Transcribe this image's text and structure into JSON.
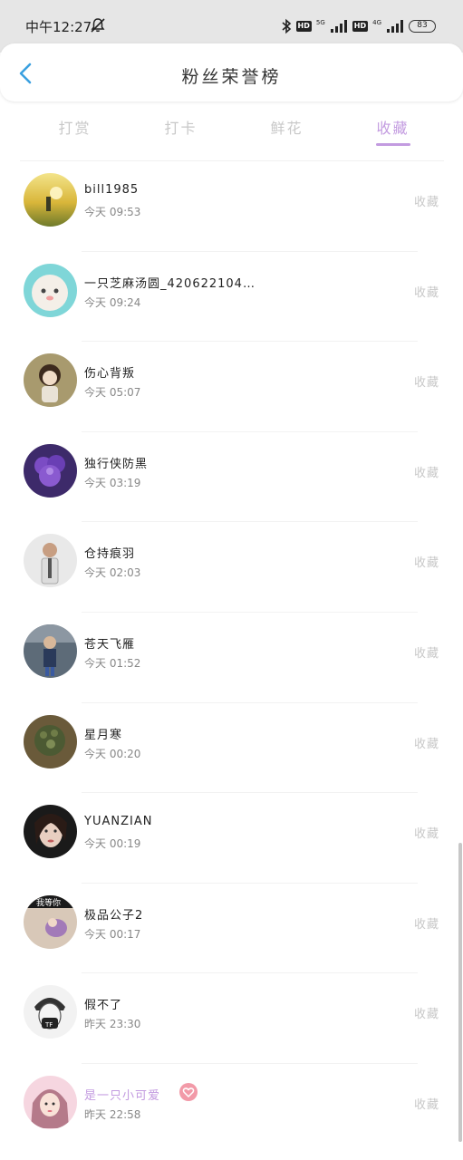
{
  "status_bar": {
    "time": "中午12:27",
    "net1": "5G",
    "net2": "4G",
    "hd": "HD",
    "battery": "83",
    "icons": [
      "bell-off-icon",
      "bluetooth-icon",
      "signal-icon",
      "battery-icon"
    ]
  },
  "header": {
    "title": "粉丝荣誉榜",
    "back_icon": "chevron-left-icon"
  },
  "tabs": [
    {
      "label": "打赏"
    },
    {
      "label": "打卡"
    },
    {
      "label": "鲜花"
    },
    {
      "label": "收藏"
    }
  ],
  "active_tab": "收藏",
  "colors": {
    "accent": "#c39be0",
    "back_arrow": "#3aa0e0",
    "status_bg": "#e6e6e6"
  },
  "fans": [
    {
      "name": "bill1985",
      "time": "今天 09:53",
      "action": "收藏"
    },
    {
      "name": "一只芝麻汤圆_420622104…",
      "time": "今天 09:24",
      "action": "收藏"
    },
    {
      "name": "伤心背叛",
      "time": "今天 05:07",
      "action": "收藏"
    },
    {
      "name": "独行侠防黑",
      "time": "今天 03:19",
      "action": "收藏"
    },
    {
      "name": "仓持痕羽",
      "time": "今天 02:03",
      "action": "收藏"
    },
    {
      "name": "苍天飞雁",
      "time": "今天 01:52",
      "action": "收藏"
    },
    {
      "name": "星月寒",
      "time": "今天 00:20",
      "action": "收藏"
    },
    {
      "name": "YUANZIAN",
      "time": "今天 00:19",
      "action": "收藏"
    },
    {
      "name": "极品公子2",
      "time": "今天 00:17",
      "action": "收藏",
      "avatar_text": "我等你"
    },
    {
      "name": "假不了",
      "time": "昨天 23:30",
      "action": "收藏"
    },
    {
      "name": "是一只小可爱",
      "time": "昨天 22:58",
      "action": "收藏",
      "vip_icon": "heart-badge-icon"
    }
  ]
}
